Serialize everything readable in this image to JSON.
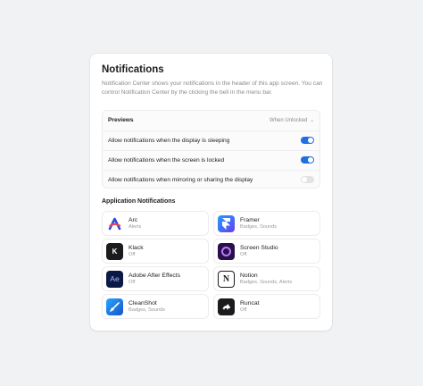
{
  "panel": {
    "title": "Notifications",
    "description": "Notification Center shows your notifications in the header of this app screen. You can control Notification Center by the clicking the bell in the menu bar."
  },
  "previews": {
    "label": "Previews",
    "selected": "When Unlocked"
  },
  "settings": [
    {
      "label": "Allow notifications when the display is sleeping",
      "enabled": true
    },
    {
      "label": "Allow notifications when the screen is locked",
      "enabled": true
    },
    {
      "label": "Allow notifications when mirroring or sharing the display",
      "enabled": false
    }
  ],
  "apps_section": {
    "title": "Application Notifications"
  },
  "apps": [
    {
      "name": "Arc",
      "status": "Alerts",
      "icon": "arc-icon"
    },
    {
      "name": "Framer",
      "status": "Badges, Sounds",
      "icon": "framer-icon"
    },
    {
      "name": "Klack",
      "status": "Off",
      "icon": "klack-icon"
    },
    {
      "name": "Screen Studio",
      "status": "Off",
      "icon": "screen-studio-icon"
    },
    {
      "name": "Adobe After Effects",
      "status": "Off",
      "icon": "after-effects-icon"
    },
    {
      "name": "Notion",
      "status": "Badges, Sounds, Alerts",
      "icon": "notion-icon"
    },
    {
      "name": "CleanShot",
      "status": "Badges, Sounds",
      "icon": "cleanshot-icon"
    },
    {
      "name": "Runcat",
      "status": "Off",
      "icon": "runcat-icon"
    }
  ],
  "icon_glyphs": {
    "klack": "K",
    "after_effects": "Ae",
    "notion": "N"
  },
  "colors": {
    "accent": "#1e6fe0",
    "toggle_off": "#e3e3e6",
    "background": "#f1f2f4"
  }
}
